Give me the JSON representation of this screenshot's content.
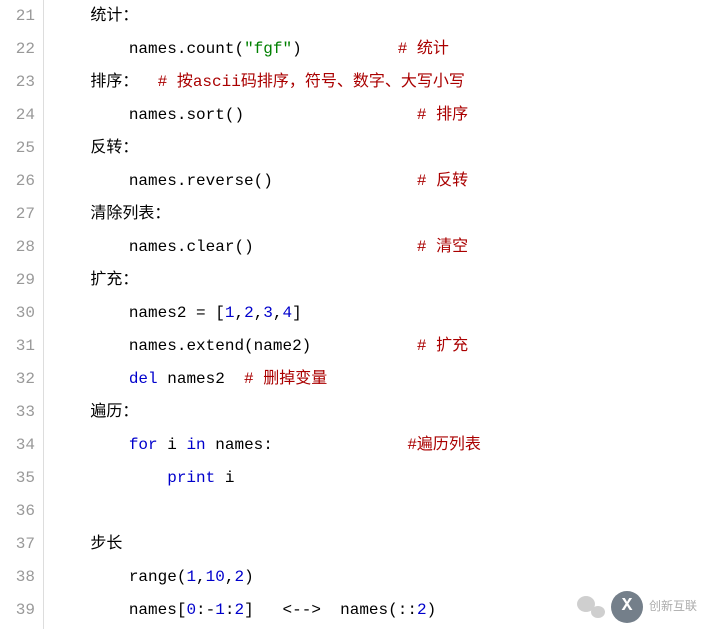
{
  "line_numbers": [
    21,
    22,
    23,
    24,
    25,
    26,
    27,
    28,
    29,
    30,
    31,
    32,
    33,
    34,
    35,
    36,
    37,
    38,
    39
  ],
  "chart_data": {
    "type": "table",
    "title": "Python list operations code snippet",
    "lines": [
      {
        "n": 21,
        "indent": 1,
        "tokens": [
          {
            "t": "text",
            "v": "统计："
          }
        ]
      },
      {
        "n": 22,
        "indent": 2,
        "tokens": [
          {
            "t": "name",
            "v": "names"
          },
          {
            "t": "punc",
            "v": "."
          },
          {
            "t": "name",
            "v": "count"
          },
          {
            "t": "punc",
            "v": "("
          },
          {
            "t": "str",
            "v": "\"fgf\""
          },
          {
            "t": "punc",
            "v": ")"
          },
          {
            "t": "pad",
            "v": "          "
          },
          {
            "t": "com",
            "v": "# 统计"
          }
        ]
      },
      {
        "n": 23,
        "indent": 1,
        "tokens": [
          {
            "t": "text",
            "v": "排序："
          },
          {
            "t": "pad",
            "v": "  "
          },
          {
            "t": "com",
            "v": "# 按ascii码排序，符号、数字、大写小写"
          }
        ]
      },
      {
        "n": 24,
        "indent": 2,
        "tokens": [
          {
            "t": "name",
            "v": "names"
          },
          {
            "t": "punc",
            "v": "."
          },
          {
            "t": "name",
            "v": "sort"
          },
          {
            "t": "punc",
            "v": "("
          },
          {
            "t": "punc",
            "v": ")"
          },
          {
            "t": "pad",
            "v": "                  "
          },
          {
            "t": "com",
            "v": "# 排序"
          }
        ]
      },
      {
        "n": 25,
        "indent": 1,
        "tokens": [
          {
            "t": "text",
            "v": "反转："
          }
        ]
      },
      {
        "n": 26,
        "indent": 2,
        "tokens": [
          {
            "t": "name",
            "v": "names"
          },
          {
            "t": "punc",
            "v": "."
          },
          {
            "t": "name",
            "v": "reverse"
          },
          {
            "t": "punc",
            "v": "("
          },
          {
            "t": "punc",
            "v": ")"
          },
          {
            "t": "pad",
            "v": "               "
          },
          {
            "t": "com",
            "v": "# 反转"
          }
        ]
      },
      {
        "n": 27,
        "indent": 1,
        "tokens": [
          {
            "t": "text",
            "v": "清除列表："
          }
        ]
      },
      {
        "n": 28,
        "indent": 2,
        "tokens": [
          {
            "t": "name",
            "v": "names"
          },
          {
            "t": "punc",
            "v": "."
          },
          {
            "t": "name",
            "v": "clear"
          },
          {
            "t": "punc",
            "v": "("
          },
          {
            "t": "punc",
            "v": ")"
          },
          {
            "t": "pad",
            "v": "                 "
          },
          {
            "t": "com",
            "v": "# 清空"
          }
        ]
      },
      {
        "n": 29,
        "indent": 1,
        "tokens": [
          {
            "t": "text",
            "v": "扩充："
          }
        ]
      },
      {
        "n": 30,
        "indent": 2,
        "tokens": [
          {
            "t": "name",
            "v": "names2"
          },
          {
            "t": "pad",
            "v": " "
          },
          {
            "t": "punc",
            "v": "="
          },
          {
            "t": "pad",
            "v": " "
          },
          {
            "t": "punc",
            "v": "["
          },
          {
            "t": "num",
            "v": "1"
          },
          {
            "t": "punc",
            "v": ","
          },
          {
            "t": "num",
            "v": "2"
          },
          {
            "t": "punc",
            "v": ","
          },
          {
            "t": "num",
            "v": "3"
          },
          {
            "t": "punc",
            "v": ","
          },
          {
            "t": "num",
            "v": "4"
          },
          {
            "t": "punc",
            "v": "]"
          }
        ]
      },
      {
        "n": 31,
        "indent": 2,
        "tokens": [
          {
            "t": "name",
            "v": "names"
          },
          {
            "t": "punc",
            "v": "."
          },
          {
            "t": "name",
            "v": "extend"
          },
          {
            "t": "punc",
            "v": "("
          },
          {
            "t": "name",
            "v": "name2"
          },
          {
            "t": "punc",
            "v": ")"
          },
          {
            "t": "pad",
            "v": "           "
          },
          {
            "t": "com",
            "v": "# 扩充"
          }
        ]
      },
      {
        "n": 32,
        "indent": 2,
        "tokens": [
          {
            "t": "kw",
            "v": "del"
          },
          {
            "t": "pad",
            "v": " "
          },
          {
            "t": "name",
            "v": "names2"
          },
          {
            "t": "pad",
            "v": "  "
          },
          {
            "t": "com",
            "v": "# 删掉变量"
          }
        ]
      },
      {
        "n": 33,
        "indent": 1,
        "tokens": [
          {
            "t": "text",
            "v": "遍历："
          }
        ]
      },
      {
        "n": 34,
        "indent": 2,
        "tokens": [
          {
            "t": "kw",
            "v": "for"
          },
          {
            "t": "pad",
            "v": " "
          },
          {
            "t": "name",
            "v": "i"
          },
          {
            "t": "pad",
            "v": " "
          },
          {
            "t": "kw",
            "v": "in"
          },
          {
            "t": "pad",
            "v": " "
          },
          {
            "t": "name",
            "v": "names"
          },
          {
            "t": "punc",
            "v": ":"
          },
          {
            "t": "pad",
            "v": "              "
          },
          {
            "t": "com",
            "v": "#遍历列表"
          }
        ]
      },
      {
        "n": 35,
        "indent": 3,
        "tokens": [
          {
            "t": "kw",
            "v": "print"
          },
          {
            "t": "pad",
            "v": " "
          },
          {
            "t": "name",
            "v": "i"
          }
        ]
      },
      {
        "n": 36,
        "indent": 0,
        "tokens": []
      },
      {
        "n": 37,
        "indent": 1,
        "tokens": [
          {
            "t": "text",
            "v": "步长"
          }
        ]
      },
      {
        "n": 38,
        "indent": 2,
        "tokens": [
          {
            "t": "name",
            "v": "range"
          },
          {
            "t": "punc",
            "v": "("
          },
          {
            "t": "num",
            "v": "1"
          },
          {
            "t": "punc",
            "v": ","
          },
          {
            "t": "num",
            "v": "10"
          },
          {
            "t": "punc",
            "v": ","
          },
          {
            "t": "num",
            "v": "2"
          },
          {
            "t": "punc",
            "v": ")"
          }
        ]
      },
      {
        "n": 39,
        "indent": 2,
        "tokens": [
          {
            "t": "name",
            "v": "names"
          },
          {
            "t": "punc",
            "v": "["
          },
          {
            "t": "num",
            "v": "0"
          },
          {
            "t": "punc",
            "v": ":"
          },
          {
            "t": "punc",
            "v": "-"
          },
          {
            "t": "num",
            "v": "1"
          },
          {
            "t": "punc",
            "v": ":"
          },
          {
            "t": "num",
            "v": "2"
          },
          {
            "t": "punc",
            "v": "]"
          },
          {
            "t": "pad",
            "v": "   "
          },
          {
            "t": "punc",
            "v": "<-->"
          },
          {
            "t": "pad",
            "v": "  "
          },
          {
            "t": "name",
            "v": "names"
          },
          {
            "t": "punc",
            "v": "("
          },
          {
            "t": "punc",
            "v": ":"
          },
          {
            "t": "punc",
            "v": ":"
          },
          {
            "t": "num",
            "v": "2"
          },
          {
            "t": "punc",
            "v": ")"
          }
        ]
      }
    ]
  },
  "watermark": {
    "brand": "创新互联",
    "logo": "X"
  },
  "indent_unit": "    "
}
